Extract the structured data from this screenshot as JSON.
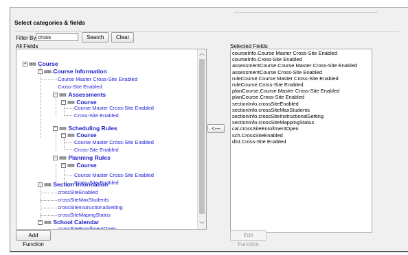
{
  "title": "Select categories & fields",
  "filter": {
    "label": "Filter By",
    "value": "cross",
    "search_label": "Search",
    "clear_label": "Clear"
  },
  "all_fields_label": "All Fields",
  "selected_fields_label": "Selected Fields",
  "tree": {
    "root": "Course",
    "course_info": "Course Information",
    "ci_master": "Course Master Cross-Site Enabled",
    "ci_enabled": "Cross-Site Enabled",
    "assessments": "Assessments",
    "as_course": "Course",
    "as_master": "Course Master Cross-Site Enabled",
    "as_enabled": "Cross-Site Enabled",
    "scheduling": "Scheduling Rules",
    "sr_course": "Course",
    "sr_master": "Course Master Cross-Site Enabled",
    "sr_enabled": "Cross-Site Enabled",
    "planning": "Planning Rules",
    "pr_course": "Course",
    "pr_master": "Course Master Cross-Site Enabled",
    "pr_enabled": "Cross-Site Enabled",
    "section_info": "Section Information",
    "si_1": "crossSiteEnabled",
    "si_2": "crossSiteMaxStudents",
    "si_3": "crossSiteInstructionalSetting",
    "si_4": "crossSiteMapingStatus",
    "school_cal": "School Calendar",
    "sc_1": "crossSiteEnrollmentOpen"
  },
  "selected_fields": [
    "courseInfo.Course Master Cross-Site Enabled",
    "courseInfo.Cross-Site Enabled",
    "assessmentCourse.Course Master Cross-Site Enabled",
    "assessmentCourse.Cross-Site Enabled",
    "ruleCourse.Course Master Cross-Site Enabled",
    "ruleCourse.Cross-Site Enabled",
    "planCourse.Course Master Cross-Site Enabled",
    "planCourse.Cross-Site Enabled",
    "sectionInfo.crossSiteEnabled",
    "sectionInfo.crossSiteMaxStudents",
    "sectionInfo.crossSiteInstructionalSetting",
    "sectionInfo.crossSiteMappingStatus",
    "cal.crossSiteEnrollmentOpen",
    "sch.CrossSiteEnabled",
    "dist.Cross-Site Enabled"
  ],
  "move_left_label": "<---",
  "add_function_label": "Add Function",
  "edit_function_label": "Edit Function",
  "icons": {
    "expand": "plus-box-icon",
    "collapse": "minus-box-icon",
    "folder": "grid-folder-icon",
    "scroll_up": "chevron-up-icon",
    "scroll_down": "chevron-down-icon"
  }
}
